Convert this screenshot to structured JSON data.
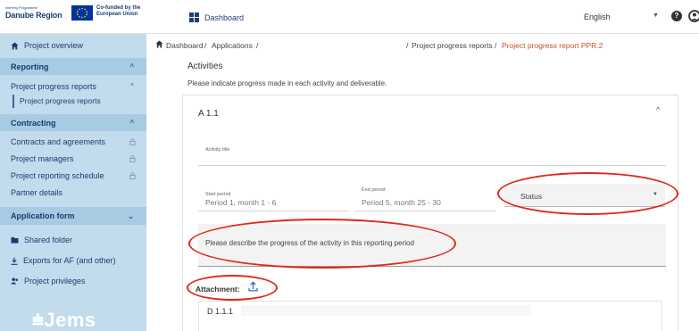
{
  "header": {
    "logo_small": "Interreg Programme",
    "logo_main": "Danube Region",
    "cofund_text": "Co-funded by the European Union",
    "dashboard_label": "Dashboard",
    "language": "English",
    "help_symbol": "?"
  },
  "sidebar": {
    "project_overview": "Project overview",
    "reporting": "Reporting",
    "project_progress_reports": "Project progress reports",
    "project_progress_reports_sub": "Project progress reports",
    "contracting": "Contracting",
    "contracts_and_agreements": "Contracts and agreements",
    "project_managers": "Project managers",
    "project_reporting_schedule": "Project reporting schedule",
    "partner_details": "Partner details",
    "application_form": "Application form",
    "shared_folder": "Shared folder",
    "exports": "Exports for AF (and other)",
    "project_privileges": "Project privileges",
    "brand": "Jems"
  },
  "breadcrumb": {
    "dashboard": "Dashboard",
    "sep1": "/",
    "applications": "Applications",
    "sep2": "/",
    "sep3": "/",
    "progress_reports": "Project progress reports",
    "sep4": "/",
    "current": "Project progress report PPR.2"
  },
  "main": {
    "activities_title": "Activities",
    "activities_desc": "Please indicate progress made in each activity and deliverable.",
    "activity_code": "A 1.1",
    "activity_title_label": "Activity title",
    "start_period_label": "Start period",
    "start_period_value": "Period 1, month 1 - 6",
    "end_period_label": "End period",
    "end_period_value": "Period 5, month 25 - 30",
    "status_label": "Status",
    "progress_placeholder": "Please describe the progress of the activity in this reporting period",
    "attachment_label": "Attachment:",
    "deliverable_code": "D 1.1.1"
  },
  "colors": {
    "sidebar_bg": "#c2dbed",
    "sidebar_section_bg": "#a7cbe3",
    "nav_text": "#1b3c6b",
    "breadcrumb_active": "#c4532a",
    "annotation_red": "#e0291c",
    "eu_blue": "#0033a0"
  }
}
